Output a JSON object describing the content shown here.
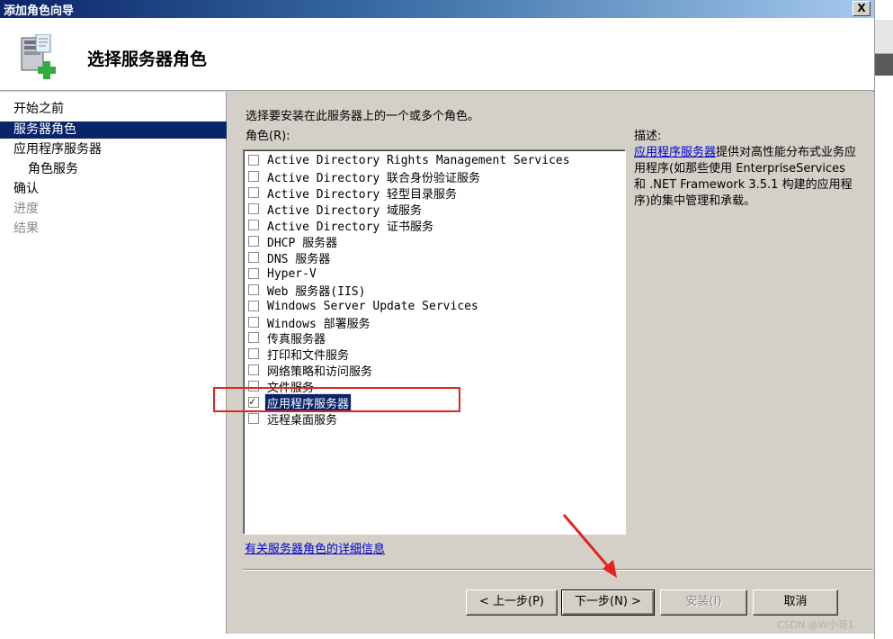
{
  "window": {
    "title": "添加角色向导",
    "close_label": "X"
  },
  "header": {
    "heading": "选择服务器角色",
    "icon": "server-add-icon"
  },
  "nav": {
    "items": [
      {
        "label": "开始之前",
        "state": "normal"
      },
      {
        "label": "服务器角色",
        "state": "active"
      },
      {
        "label": "应用程序服务器",
        "state": "normal"
      },
      {
        "label": "角色服务",
        "state": "sub"
      },
      {
        "label": "确认",
        "state": "normal"
      },
      {
        "label": "进度",
        "state": "disabled"
      },
      {
        "label": "结果",
        "state": "disabled"
      }
    ]
  },
  "content": {
    "instruction": "选择要安装在此服务器上的一个或多个角色。",
    "roles_label": "角色(R):",
    "roles": [
      {
        "label": "Active Directory Rights Management Services",
        "checked": false,
        "selected": false
      },
      {
        "label": "Active Directory 联合身份验证服务",
        "checked": false,
        "selected": false
      },
      {
        "label": "Active Directory 轻型目录服务",
        "checked": false,
        "selected": false
      },
      {
        "label": "Active Directory 域服务",
        "checked": false,
        "selected": false
      },
      {
        "label": "Active Directory 证书服务",
        "checked": false,
        "selected": false
      },
      {
        "label": "DHCP 服务器",
        "checked": false,
        "selected": false
      },
      {
        "label": "DNS 服务器",
        "checked": false,
        "selected": false
      },
      {
        "label": "Hyper-V",
        "checked": false,
        "selected": false
      },
      {
        "label": "Web 服务器(IIS)",
        "checked": false,
        "selected": false
      },
      {
        "label": "Windows Server Update Services",
        "checked": false,
        "selected": false
      },
      {
        "label": "Windows 部署服务",
        "checked": false,
        "selected": false
      },
      {
        "label": "传真服务器",
        "checked": false,
        "selected": false
      },
      {
        "label": "打印和文件服务",
        "checked": false,
        "selected": false
      },
      {
        "label": "网络策略和访问服务",
        "checked": false,
        "selected": false
      },
      {
        "label": "文件服务",
        "checked": false,
        "selected": false
      },
      {
        "label": "应用程序服务器",
        "checked": true,
        "selected": true
      },
      {
        "label": "远程桌面服务",
        "checked": false,
        "selected": false
      }
    ],
    "description_title": "描述:",
    "description_link": "应用程序服务器",
    "description_text": "提供对高性能分布式业务应用程序(如那些使用 EnterpriseServices 和 .NET Framework 3.5.1 构建的应用程序)的集中管理和承载。",
    "more_info_link": "有关服务器角色的详细信息"
  },
  "buttons": {
    "back": "< 上一步(P)",
    "next": "下一步(N) >",
    "install": "安装(I)",
    "cancel": "取消"
  },
  "watermark": "CSDN @W小哥1",
  "colors": {
    "highlight": "#e52222",
    "selection": "#0a246a",
    "link": "#0000cc"
  }
}
